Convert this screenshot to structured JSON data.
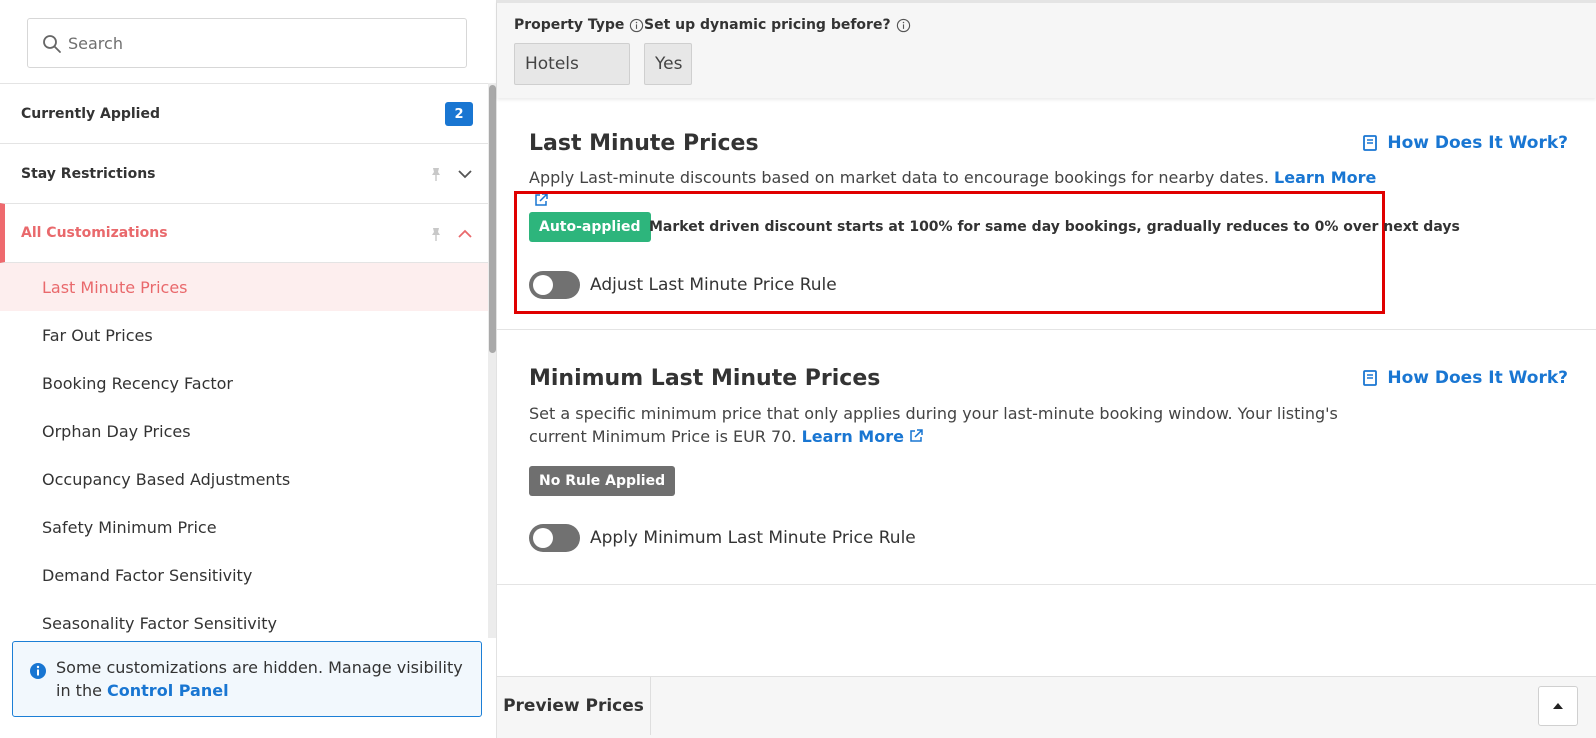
{
  "sidebar": {
    "search_placeholder": "Search",
    "sections": [
      {
        "label": "Currently Applied",
        "badge": "2"
      },
      {
        "label": "Stay Restrictions"
      },
      {
        "label": "All Customizations"
      }
    ],
    "items": [
      "Last Minute Prices",
      "Far Out Prices",
      "Booking Recency Factor",
      "Orphan Day Prices",
      "Occupancy Based Adjustments",
      "Safety Minimum Price",
      "Demand Factor Sensitivity",
      "Seasonality Factor Sensitivity"
    ],
    "selected_item": "Last Minute Prices",
    "notice": {
      "text": "Some customizations are hidden. Manage visibility in the",
      "link": "Control Panel"
    }
  },
  "filters": {
    "property_type": {
      "label": "Property Type",
      "value": "Hotels"
    },
    "dynamic_pricing": {
      "label": "Set up dynamic pricing before?",
      "value": "Yes"
    }
  },
  "last_minute": {
    "title": "Last Minute Prices",
    "how_link": "How Does It Work?",
    "description": "Apply Last-minute discounts based on market data to encourage bookings for nearby dates.",
    "learn_more": "Learn More",
    "tag": "Auto-applied",
    "tag_text": "Market driven discount starts at 100% for same day bookings, gradually reduces to 0% over next days",
    "toggle_label": "Adjust Last Minute Price Rule"
  },
  "min_last_minute": {
    "title": "Minimum Last Minute Prices",
    "how_link": "How Does It Work?",
    "description": "Set a specific minimum price that only applies during your last-minute booking window. Your listing's current Minimum Price is EUR 70.",
    "learn_more": "Learn More",
    "tag": "No Rule Applied",
    "toggle_label": "Apply Minimum Last Minute Price Rule"
  },
  "bottom": {
    "preview": "Preview Prices"
  },
  "colors": {
    "accent_blue": "#1976d2",
    "active_red": "#e9696c",
    "auto_green": "#2db57c",
    "highlight_red": "#e00000"
  }
}
